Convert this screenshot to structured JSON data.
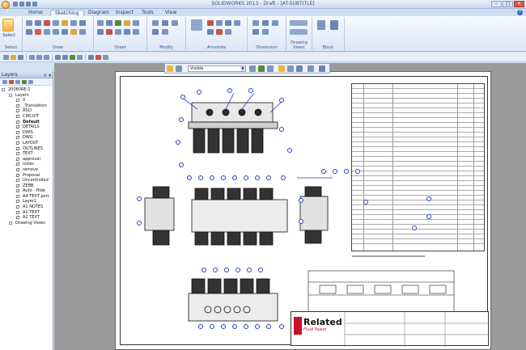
{
  "app": {
    "title": "SOLIDWORKS 2013 - Draft - [AT-SUBTITLE]",
    "window_controls": [
      "–",
      "□",
      "×"
    ]
  },
  "ribbon": {
    "tabs": [
      "Home",
      "Sketching",
      "Diagram",
      "Inspect",
      "Tools",
      "View"
    ],
    "active_tab": "Sketching",
    "groups": [
      "Select",
      "Draw",
      "Sheet",
      "Modify",
      "Annotate",
      "Dimension",
      "Drawing Views",
      "Block"
    ],
    "select_label": "Select"
  },
  "drawing_toolbar": {
    "layer_value": "Visible"
  },
  "layers_panel": {
    "title": "Layers",
    "close_icon": "close-icon",
    "items": [
      {
        "label": "20080RE-1",
        "level": 0,
        "type": "root"
      },
      {
        "label": "Layers",
        "level": 1,
        "type": "folder"
      },
      {
        "label": "0",
        "level": 2,
        "type": "layer"
      },
      {
        "label": "_Translation",
        "level": 2,
        "type": "layer"
      },
      {
        "label": "ASCI",
        "level": 2,
        "type": "layer"
      },
      {
        "label": "CIRCUIT",
        "level": 2,
        "type": "layer"
      },
      {
        "label": "Default",
        "level": 2,
        "type": "layer",
        "active": true
      },
      {
        "label": "DETAILS",
        "level": 2,
        "type": "layer"
      },
      {
        "label": "DIMS",
        "level": 2,
        "type": "layer"
      },
      {
        "label": "DWG",
        "level": 2,
        "type": "layer"
      },
      {
        "label": "LAYOUT",
        "level": 2,
        "type": "layer"
      },
      {
        "label": "OUTLINES",
        "level": 2,
        "type": "layer"
      },
      {
        "label": "TEXT",
        "level": 2,
        "type": "layer"
      },
      {
        "label": "approval",
        "level": 2,
        "type": "layer"
      },
      {
        "label": "notes",
        "level": 2,
        "type": "layer"
      },
      {
        "label": "remove",
        "level": 2,
        "type": "layer"
      },
      {
        "label": "Proposal",
        "level": 2,
        "type": "layer"
      },
      {
        "label": "Uncontrolled",
        "level": 2,
        "type": "layer"
      },
      {
        "label": "ZEBB",
        "level": 2,
        "type": "layer"
      },
      {
        "label": "Auto - Hide",
        "level": 2,
        "type": "layer"
      },
      {
        "label": "A4 TEXT port",
        "level": 2,
        "type": "layer"
      },
      {
        "label": "Layer1",
        "level": 2,
        "type": "layer"
      },
      {
        "label": "A1 NOTES",
        "level": 2,
        "type": "layer"
      },
      {
        "label": "A1 TEXT",
        "level": 2,
        "type": "layer"
      },
      {
        "label": "A2 TEXT",
        "level": 2,
        "type": "layer"
      },
      {
        "label": "Drawing Views",
        "level": 1,
        "type": "folder"
      }
    ]
  },
  "drawing": {
    "logo_word": "Related",
    "logo_sub": "Fluid Power"
  },
  "colors": {
    "balloon": "#2840c8",
    "logo_red": "#c8102e",
    "ribbon_active": "#f6b43f"
  }
}
